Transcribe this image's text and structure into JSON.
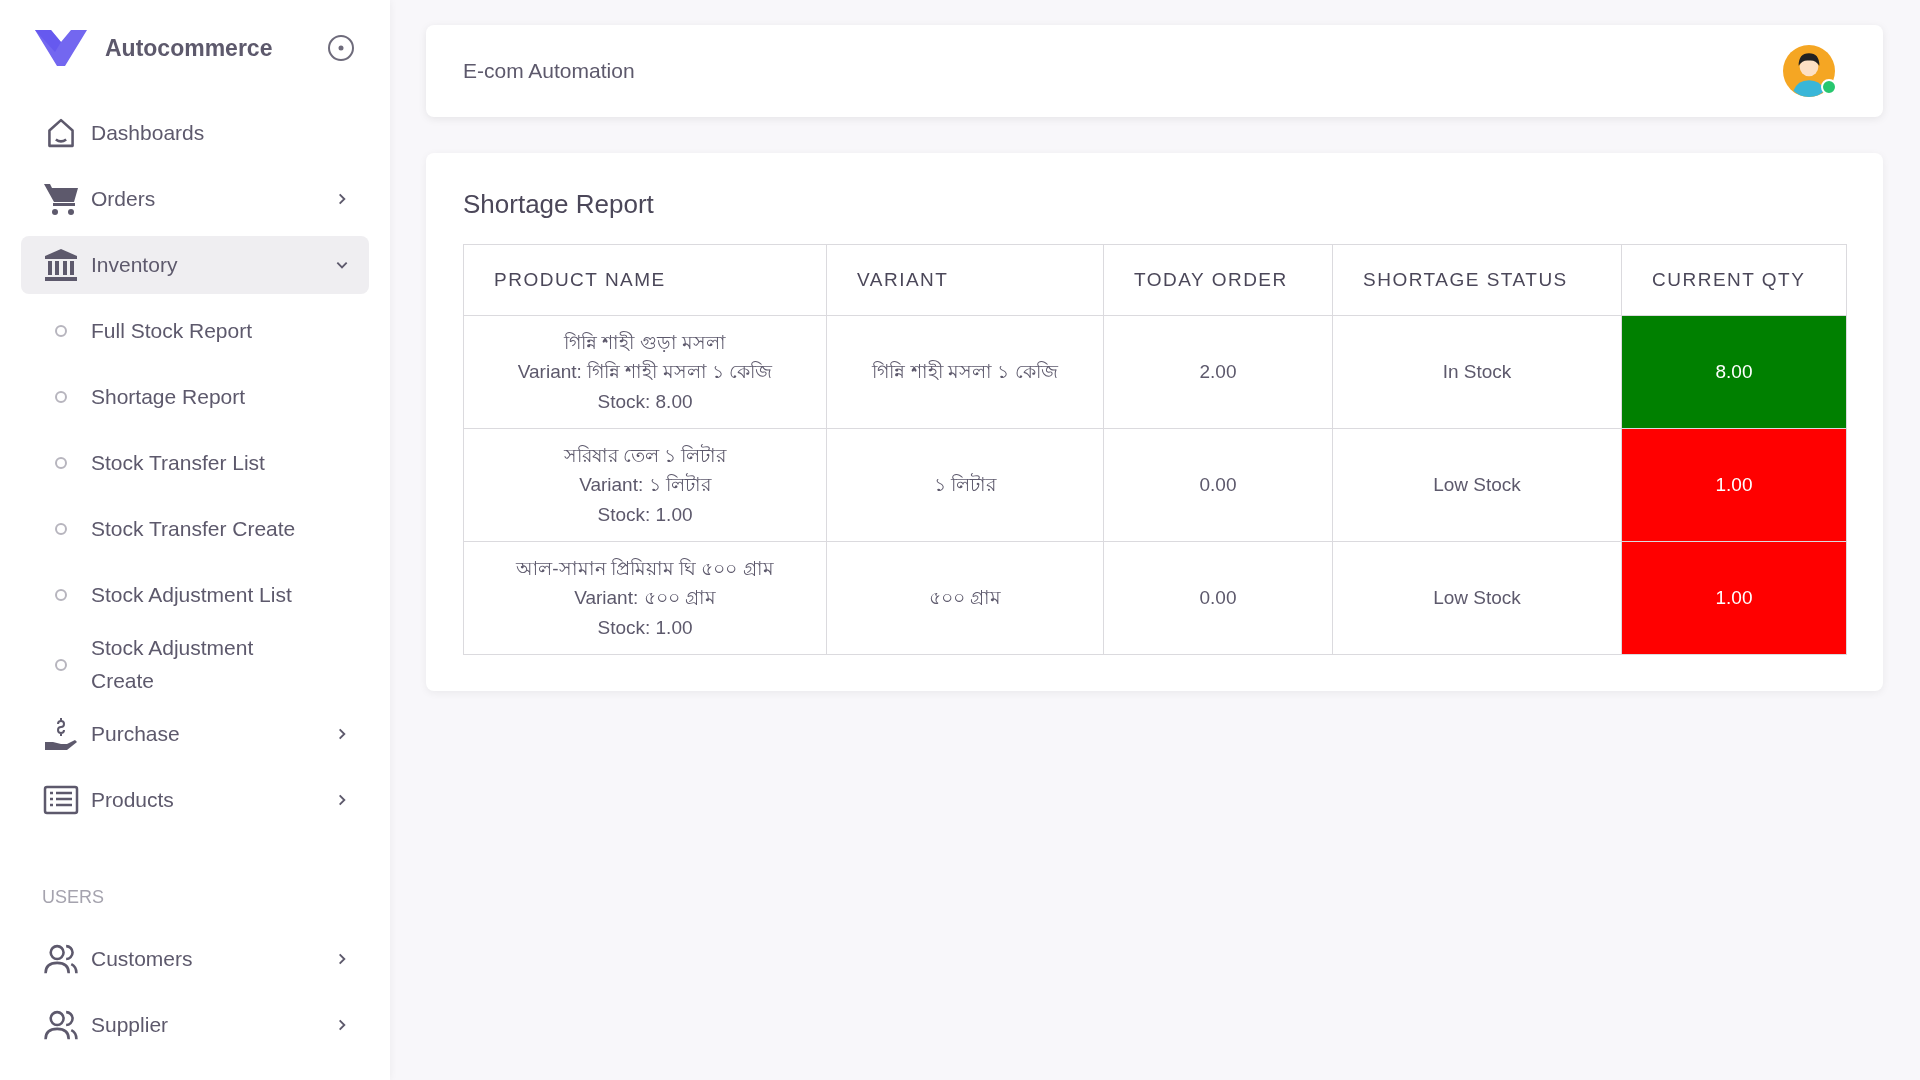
{
  "sidebar": {
    "brand": "Autocommerce",
    "items": [
      {
        "label": "Dashboards",
        "selected": false
      },
      {
        "label": "Orders",
        "selected": false,
        "expanded": false
      },
      {
        "label": "Inventory",
        "selected": true,
        "expanded": true,
        "children": [
          {
            "label": "Full Stock Report"
          },
          {
            "label": "Shortage Report"
          },
          {
            "label": "Stock Transfer List"
          },
          {
            "label": "Stock Transfer Create"
          },
          {
            "label": "Stock Adjustment List"
          },
          {
            "label": "Stock Adjustment Create"
          }
        ]
      },
      {
        "label": "Purchase",
        "selected": false,
        "expanded": false
      },
      {
        "label": "Products",
        "selected": false,
        "expanded": false
      }
    ],
    "section": "USERS",
    "user_items": [
      {
        "label": "Customers",
        "selected": false,
        "expanded": false
      },
      {
        "label": "Supplier",
        "selected": false,
        "expanded": false
      }
    ]
  },
  "header": {
    "title": "E-com Automation",
    "user_online": true
  },
  "report": {
    "title": "Shortage Report",
    "columns": [
      "PRODUCT NAME",
      "VARIANT",
      "TODAY ORDER",
      "SHORTAGE STATUS",
      "CURRENT QTY"
    ],
    "rows": [
      {
        "product": "গিন্নি শাহী গুড়া মসলা",
        "product_variant": "Variant: গিন্নি শাহী মসলা ১ কেজি",
        "stock": "Stock: 8.00",
        "variant": "গিন্নি শাহী মসলা ১ কেজি",
        "today_order": "2.00",
        "status": "In Stock",
        "current_qty": "8.00",
        "color": "#008000"
      },
      {
        "product": "সরিষার তেল ১ লিটার",
        "product_variant": "Variant: ১ লিটার",
        "stock": "Stock: 1.00",
        "variant": "১ লিটার",
        "today_order": "0.00",
        "status": "Low Stock",
        "current_qty": "1.00",
        "color": "#ff0000"
      },
      {
        "product": "আল-সামান প্রিমিয়াম ঘি ৫০০ গ্রাম",
        "product_variant": "Variant: ৫০০ গ্রাম",
        "stock": "Stock: 1.00",
        "variant": "৫০০ গ্রাম",
        "today_order": "0.00",
        "status": "Low Stock",
        "current_qty": "1.00",
        "color": "#ff0000"
      }
    ]
  }
}
